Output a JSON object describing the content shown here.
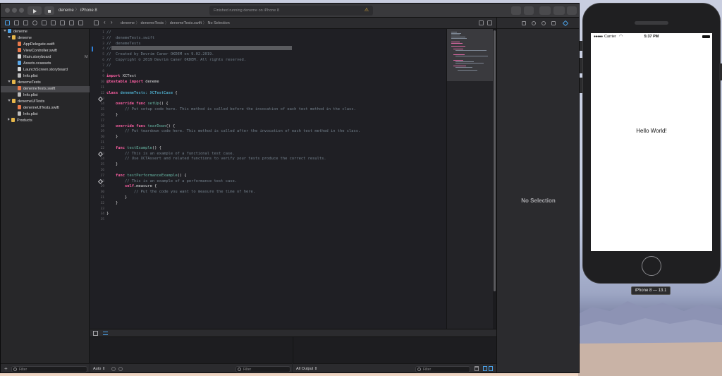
{
  "window": {
    "scheme_target": "deneme",
    "scheme_device": "iPhone 8",
    "activity_status": "Finished running deneme on iPhone 8",
    "jump_bar": [
      "deneme",
      "denemeTests",
      "denemeTests.swift",
      "No Selection"
    ]
  },
  "navigator": {
    "items": [
      {
        "label": "deneme",
        "kind": "project"
      },
      {
        "label": "deneme",
        "kind": "folder"
      },
      {
        "label": "AppDelegate.swift",
        "kind": "swift"
      },
      {
        "label": "ViewController.swift",
        "kind": "swift"
      },
      {
        "label": "Main.storyboard",
        "kind": "storyboard",
        "badge": "M"
      },
      {
        "label": "Assets.xcassets",
        "kind": "assets"
      },
      {
        "label": "LaunchScreen.storyboard",
        "kind": "storyboard"
      },
      {
        "label": "Info.plist",
        "kind": "plist"
      },
      {
        "label": "denemeTests",
        "kind": "folder"
      },
      {
        "label": "denemeTests.swift",
        "kind": "swift",
        "selected": true
      },
      {
        "label": "Info.plist",
        "kind": "plist"
      },
      {
        "label": "denemeUITests",
        "kind": "folder"
      },
      {
        "label": "denemeUITests.swift",
        "kind": "swift"
      },
      {
        "label": "Info.plist",
        "kind": "plist"
      },
      {
        "label": "Products",
        "kind": "folder"
      }
    ],
    "filter_placeholder": "Filter"
  },
  "editor": {
    "lines": [
      [
        [
          "//",
          "com"
        ]
      ],
      [
        [
          "//  denemeTests.swift",
          "com"
        ]
      ],
      [
        [
          "//  denemeTests",
          "com"
        ]
      ],
      [
        [
          "//",
          "com"
        ]
      ],
      [
        [
          "//  Created by Devrim Caner OKDEM on 9.02.2019.",
          "com"
        ]
      ],
      [
        [
          "//  Copyright © 2019 Devrim Caner OKDEM. All rights reserved.",
          "com"
        ]
      ],
      [
        [
          "//",
          "com"
        ]
      ],
      [],
      [
        [
          "import",
          "kw"
        ],
        [
          " XCTest",
          "plain"
        ]
      ],
      [
        [
          "@testable",
          "kw"
        ],
        [
          " ",
          "plain"
        ],
        [
          "import",
          "kw"
        ],
        [
          " deneme",
          "plain"
        ]
      ],
      [],
      [
        [
          "class",
          "kw"
        ],
        [
          " denemeTests: ",
          "type"
        ],
        [
          "XCTestCase",
          "type"
        ],
        [
          " {",
          "plain"
        ]
      ],
      [],
      [
        [
          "    override",
          "kw"
        ],
        [
          " ",
          "plain"
        ],
        [
          "func",
          "kw"
        ],
        [
          " ",
          "plain"
        ],
        [
          "setUp",
          "fn"
        ],
        [
          "() {",
          "plain"
        ]
      ],
      [
        [
          "        // Put setup code here. This method is called before the invocation of each test method in the class.",
          "com"
        ]
      ],
      [
        [
          "    }",
          "plain"
        ]
      ],
      [],
      [
        [
          "    override",
          "kw"
        ],
        [
          " ",
          "plain"
        ],
        [
          "func",
          "kw"
        ],
        [
          " ",
          "plain"
        ],
        [
          "tearDown",
          "fn"
        ],
        [
          "() {",
          "plain"
        ]
      ],
      [
        [
          "        // Put teardown code here. This method is called after the invocation of each test method in the class.",
          "com"
        ]
      ],
      [
        [
          "    }",
          "plain"
        ]
      ],
      [],
      [
        [
          "    func",
          "kw"
        ],
        [
          " ",
          "plain"
        ],
        [
          "testExample",
          "fn"
        ],
        [
          "() {",
          "plain"
        ]
      ],
      [
        [
          "        // This is an example of a functional test case.",
          "com"
        ]
      ],
      [
        [
          "        // Use XCTAssert and related functions to verify your tests produce the correct results.",
          "com"
        ]
      ],
      [
        [
          "    }",
          "plain"
        ]
      ],
      [],
      [
        [
          "    func",
          "kw"
        ],
        [
          " ",
          "plain"
        ],
        [
          "testPerformanceExample",
          "fn"
        ],
        [
          "() {",
          "plain"
        ]
      ],
      [
        [
          "        // This is an example of a performance test case.",
          "com"
        ]
      ],
      [
        [
          "        ",
          "plain"
        ],
        [
          "self",
          "kw"
        ],
        [
          ".measure {",
          "plain"
        ]
      ],
      [
        [
          "            // Put the code you want to measure the time of here.",
          "com"
        ]
      ],
      [
        [
          "        }",
          "plain"
        ]
      ],
      [
        [
          "    }",
          "plain"
        ]
      ],
      [],
      [
        [
          "}",
          "plain"
        ]
      ],
      []
    ],
    "test_diamond_lines": [
      12,
      22,
      27
    ]
  },
  "debug": {
    "auto_label": "Auto",
    "output_label": "All Output",
    "filter_placeholder": "Filter"
  },
  "inspector": {
    "empty_label": "No Selection"
  },
  "simulator": {
    "carrier": "Carrier",
    "time": "5:37 PM",
    "hello_text": "Hello World!",
    "device_label": "iPhone 8 — 13.1"
  },
  "colors": {
    "keyword": "#fc5fa3",
    "type": "#5dd8ff",
    "function": "#67b7a4",
    "comment": "#73808c",
    "plain": "#dfdfe0",
    "accent": "#2f80d9"
  }
}
